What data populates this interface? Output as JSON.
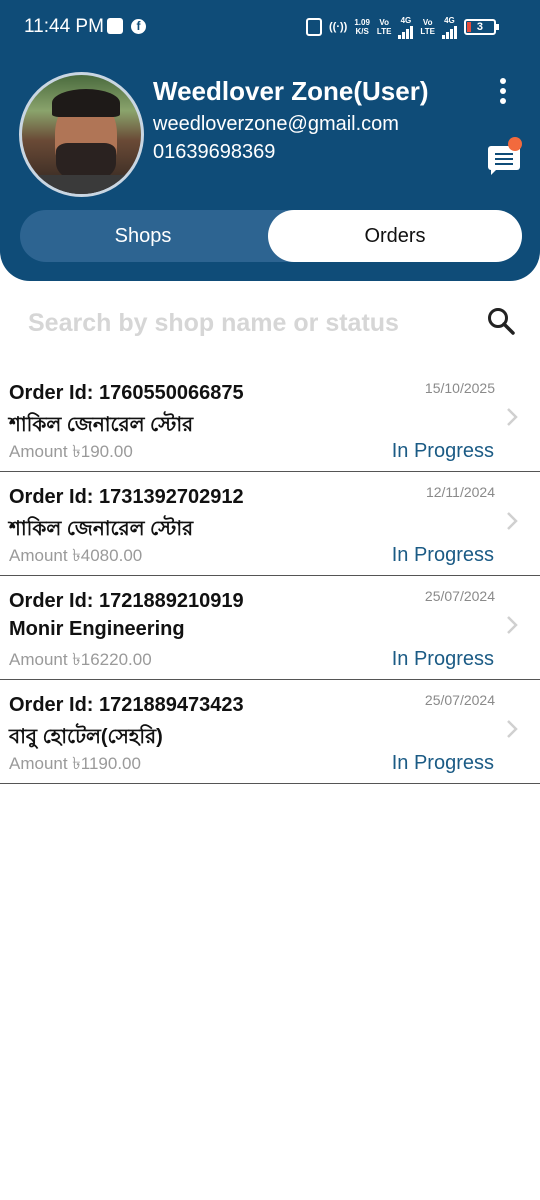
{
  "status_bar": {
    "time": "11:44 PM",
    "net_speed_top": "1.09",
    "net_speed_unit": "K/S",
    "sim1_top": "Vo",
    "sim1_bottom": "LTE",
    "sim1_tech": "4G",
    "sim2_top": "Vo",
    "sim2_bottom": "LTE",
    "sim2_tech": "4G",
    "battery": "3"
  },
  "profile": {
    "name": "Weedlover Zone(User)",
    "email": "weedloverzone@gmail.com",
    "phone": "01639698369"
  },
  "tabs": {
    "shops_label": "Shops",
    "orders_label": "Orders",
    "active": "Orders"
  },
  "search": {
    "placeholder": "Search by shop name or status",
    "value": ""
  },
  "orders": [
    {
      "id_text": "Order Id: 1760550066875",
      "shop": "শাকিল জেনারেল স্টোর",
      "amount": "Amount ৳190.00",
      "date": "15/10/2025",
      "status": "In Progress"
    },
    {
      "id_text": "Order Id: 1731392702912",
      "shop": "শাকিল জেনারেল স্টোর",
      "amount": "Amount ৳4080.00",
      "date": "12/11/2024",
      "status": "In Progress"
    },
    {
      "id_text": "Order Id: 1721889210919",
      "shop": "Monir Engineering",
      "amount": "Amount ৳16220.00",
      "date": "25/07/2024",
      "status": "In Progress"
    },
    {
      "id_text": "Order Id: 1721889473423",
      "shop": "বাবু হোটেল(সেহরি)",
      "amount": "Amount ৳1190.00",
      "date": "25/07/2024",
      "status": "In Progress"
    }
  ],
  "colors": {
    "header_bg": "#0f4c78",
    "tab_track": "#2d6491",
    "status_text": "#1b5b85",
    "notification_dot": "#f26a3d"
  },
  "icons": {
    "menu": "kebab-menu-icon",
    "chat": "chat-bubble-icon",
    "search": "search-icon",
    "row_arrow": "chevron-right-icon"
  }
}
